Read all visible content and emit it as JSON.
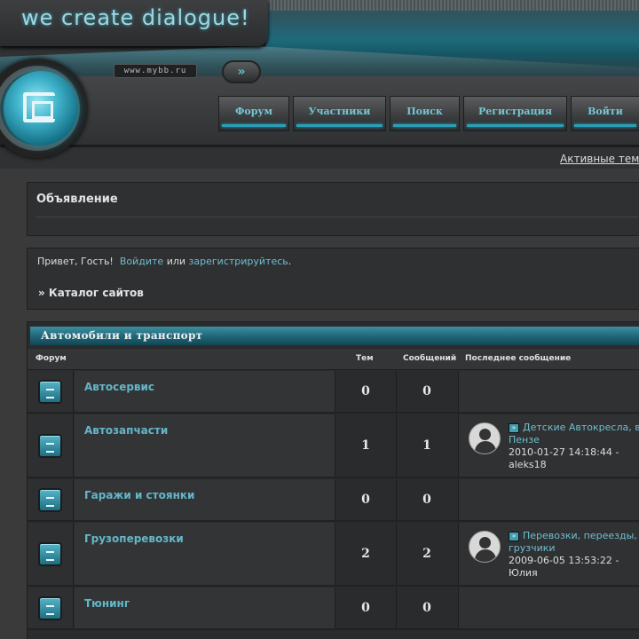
{
  "header": {
    "slogan": "we create dialogue!",
    "url": "www.mybb.ru",
    "go_label": "»"
  },
  "nav": [
    {
      "label": "Форум",
      "width": 80
    },
    {
      "label": "Участники",
      "width": 105
    },
    {
      "label": "Поиск",
      "width": 79
    },
    {
      "label": "Регистрация",
      "width": 117
    },
    {
      "label": "Войти",
      "width": 78
    }
  ],
  "active_topics": "Активные темы",
  "announcement": {
    "title": "Объявление"
  },
  "welcome": {
    "prefix": "Привет, Гость!",
    "login": "Войдите",
    "or": "или",
    "register": "зарегистрируйтесь",
    "suffix": ".",
    "catalog": "» Каталог сайтов"
  },
  "category": {
    "title": "Автомобили и транспорт",
    "columns": {
      "forum": "Форум",
      "topics": "Тем",
      "posts": "Сообщений",
      "last": "Последнее сообщение"
    },
    "rows": [
      {
        "name": "Автосервис",
        "topics": "0",
        "posts": "0",
        "last": null
      },
      {
        "name": "Автозапчасти",
        "topics": "1",
        "posts": "1",
        "last": {
          "title": "Детские Автокресла, в Пензе",
          "date": "2010-01-27 14:18:44 -",
          "user": "aleks18"
        }
      },
      {
        "name": "Гаражи и стоянки",
        "topics": "0",
        "posts": "0",
        "last": null
      },
      {
        "name": "Грузоперевозки",
        "topics": "2",
        "posts": "2",
        "last": {
          "title": "Перевозки, переезды, грузчики",
          "date": "2009-06-05 13:53:22 -",
          "user": "Юлия"
        }
      },
      {
        "name": "Тюнинг",
        "topics": "0",
        "posts": "0",
        "last": null
      }
    ]
  }
}
